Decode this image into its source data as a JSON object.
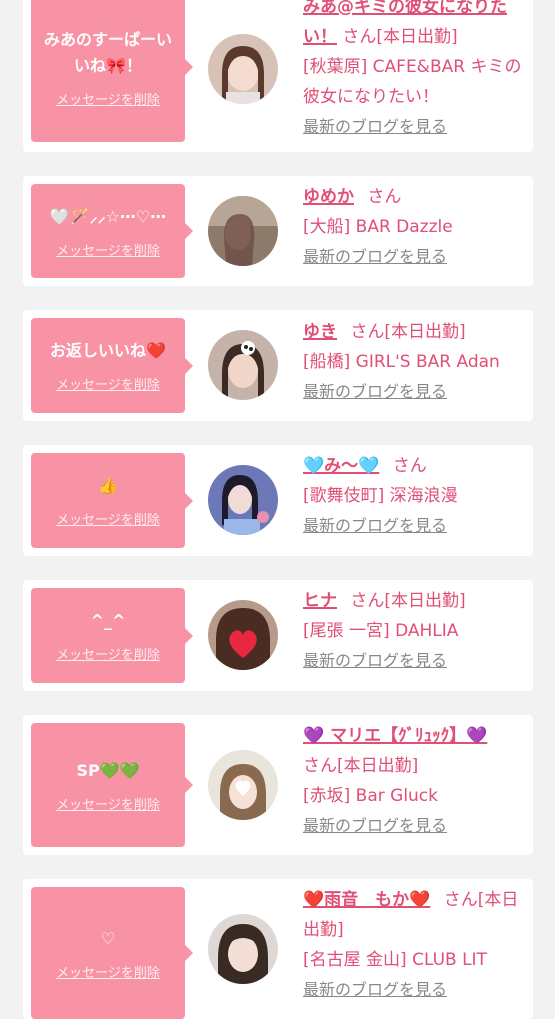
{
  "delete_label": "メッセージを削除",
  "blog_label": "最新のブログを見る",
  "items": [
    {
      "message": "みあのすーぱーいいね🎀！",
      "name": "みあ@キミの彼女になりたい！",
      "suffix": "さん[本日出勤]",
      "shop": "[秋葉原] CAFE&BAR キミの彼女になりたい！"
    },
    {
      "message": "🤍🪄⸝⸝☆⋯♡⋯",
      "name": "ゆめか",
      "suffix": "さん",
      "shop": "[大船] BAR Dazzle"
    },
    {
      "message": "お返しいいね❤️",
      "name": "ゆき",
      "suffix": "さん[本日出勤]",
      "shop": "[船橋] GIRL'S BAR Adan"
    },
    {
      "message": "👍",
      "name": "🩵み〜🩵",
      "suffix": "さん",
      "shop": "[歌舞伎町] 深海浪漫"
    },
    {
      "message": "^_^",
      "name": "ヒナ",
      "suffix": "さん[本日出勤]",
      "shop": "[尾張 一宮] DAHLIA"
    },
    {
      "message": "SP💚💚",
      "name": "💜 マリエ【ｸﾞﾘｭｯｸ】💜",
      "suffix": "さん[本日出勤]",
      "shop": "[赤坂] Bar Gluck"
    },
    {
      "message": "♡",
      "name": "❤️雨音　もか❤️",
      "suffix": "さん[本日出勤]",
      "shop": "[名古屋 金山] CLUB LIT"
    }
  ]
}
